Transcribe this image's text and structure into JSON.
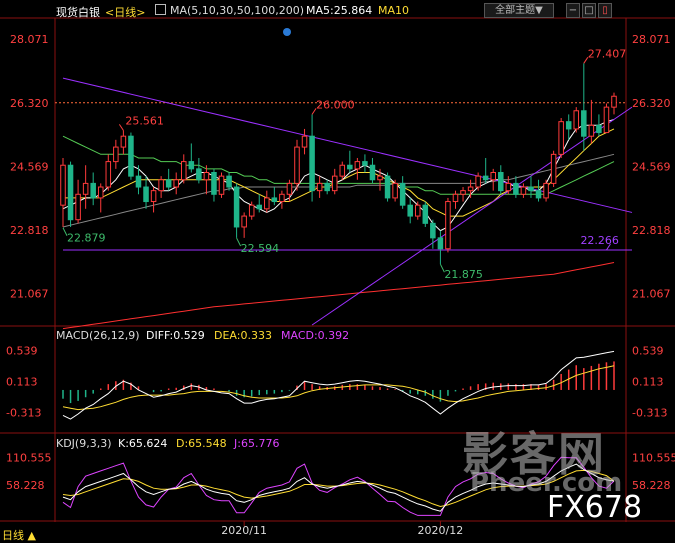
{
  "header": {
    "symbol_label": "现货白银",
    "period_label": "<日线>",
    "ma_label": "MA(5,10,30,50,100,200)",
    "ma5_label": "MA5:25.864",
    "ma10_label": "MA10",
    "theme_button": "全部主题▼"
  },
  "price_panel": {
    "y_ticks": [
      "28.071",
      "26.320",
      "24.569",
      "22.818",
      "21.067"
    ],
    "annotations": [
      {
        "text": "27.407",
        "color": "#ff4040"
      },
      {
        "text": "26.000",
        "color": "#ff4040"
      },
      {
        "text": "25.561",
        "color": "#ff4040"
      },
      {
        "text": "22.879",
        "color": "#3dbb6a"
      },
      {
        "text": "22.594",
        "color": "#3dbb6a"
      },
      {
        "text": "21.875",
        "color": "#3dbb6a"
      },
      {
        "text": "22.266",
        "color": "#a040ff"
      }
    ]
  },
  "macd_panel": {
    "label": "MACD(26,12,9)",
    "diff": "DIFF:0.529",
    "dea": "DEA:0.333",
    "macd": "MACD:0.392",
    "y_ticks": [
      "0.539",
      "0.113",
      "-0.313"
    ]
  },
  "kdj_panel": {
    "label": "KDJ(9,3,3)",
    "k": "K:65.624",
    "d": "D:65.548",
    "j": "J:65.776",
    "y_ticks": [
      "110.555",
      "58.228"
    ]
  },
  "x_axis": {
    "bottom_left_label": "日线 ▲",
    "ticks": [
      "2020/11",
      "2020/12"
    ]
  },
  "watermark": {
    "text1": "影客网",
    "text2": "Pheer.com",
    "text3": "FX678"
  },
  "colors": {
    "up": "#ff3b3b",
    "down": "#1fb58a",
    "ma5": "#ffffff",
    "ma10": "#ffdd33",
    "ma30": "#55cc55",
    "ma50": "#888888",
    "ma200": "#ff3030",
    "trend": "#9b30ff",
    "diff": "#ffffff",
    "dea": "#ffdd33",
    "k": "#ffffff",
    "d": "#ffdd33",
    "j": "#dd44ff"
  },
  "chart_data": {
    "type": "candlestick",
    "ylim": [
      20.2,
      28.6
    ],
    "candles": [
      {
        "o": 23.5,
        "h": 24.8,
        "l": 22.9,
        "c": 24.6
      },
      {
        "o": 24.6,
        "h": 24.7,
        "l": 22.9,
        "c": 23.1
      },
      {
        "o": 23.1,
        "h": 24.2,
        "l": 23.0,
        "c": 23.8
      },
      {
        "o": 23.8,
        "h": 24.6,
        "l": 23.4,
        "c": 24.1
      },
      {
        "o": 24.1,
        "h": 24.4,
        "l": 23.5,
        "c": 23.7
      },
      {
        "o": 23.7,
        "h": 24.1,
        "l": 23.3,
        "c": 24.0
      },
      {
        "o": 24.0,
        "h": 24.9,
        "l": 23.9,
        "c": 24.7
      },
      {
        "o": 24.7,
        "h": 25.3,
        "l": 24.5,
        "c": 25.1
      },
      {
        "o": 25.1,
        "h": 25.56,
        "l": 24.9,
        "c": 25.4
      },
      {
        "o": 25.4,
        "h": 25.5,
        "l": 24.2,
        "c": 24.3
      },
      {
        "o": 24.3,
        "h": 24.6,
        "l": 23.8,
        "c": 24.0
      },
      {
        "o": 24.0,
        "h": 24.3,
        "l": 23.4,
        "c": 23.6
      },
      {
        "o": 23.6,
        "h": 24.0,
        "l": 23.3,
        "c": 23.9
      },
      {
        "o": 23.9,
        "h": 24.3,
        "l": 23.7,
        "c": 24.2
      },
      {
        "o": 24.2,
        "h": 24.5,
        "l": 23.9,
        "c": 24.0
      },
      {
        "o": 24.0,
        "h": 24.4,
        "l": 23.8,
        "c": 24.2
      },
      {
        "o": 24.2,
        "h": 24.9,
        "l": 24.1,
        "c": 24.7
      },
      {
        "o": 24.7,
        "h": 25.2,
        "l": 24.4,
        "c": 24.5
      },
      {
        "o": 24.5,
        "h": 24.8,
        "l": 24.1,
        "c": 24.2
      },
      {
        "o": 24.2,
        "h": 24.6,
        "l": 23.8,
        "c": 24.4
      },
      {
        "o": 24.4,
        "h": 24.5,
        "l": 23.6,
        "c": 23.8
      },
      {
        "o": 23.8,
        "h": 24.4,
        "l": 23.7,
        "c": 24.3
      },
      {
        "o": 24.3,
        "h": 24.4,
        "l": 23.9,
        "c": 24.0
      },
      {
        "o": 24.0,
        "h": 24.1,
        "l": 22.6,
        "c": 22.9
      },
      {
        "o": 22.9,
        "h": 23.3,
        "l": 22.6,
        "c": 23.2
      },
      {
        "o": 23.2,
        "h": 23.6,
        "l": 23.1,
        "c": 23.5
      },
      {
        "o": 23.5,
        "h": 23.8,
        "l": 23.3,
        "c": 23.4
      },
      {
        "o": 23.4,
        "h": 23.9,
        "l": 23.3,
        "c": 23.7
      },
      {
        "o": 23.7,
        "h": 24.0,
        "l": 23.5,
        "c": 23.6
      },
      {
        "o": 23.6,
        "h": 23.9,
        "l": 23.4,
        "c": 23.8
      },
      {
        "o": 23.8,
        "h": 24.2,
        "l": 23.6,
        "c": 24.1
      },
      {
        "o": 24.1,
        "h": 25.3,
        "l": 23.9,
        "c": 25.1
      },
      {
        "o": 25.1,
        "h": 25.6,
        "l": 24.9,
        "c": 25.4
      },
      {
        "o": 25.4,
        "h": 26.0,
        "l": 23.6,
        "c": 23.9
      },
      {
        "o": 23.9,
        "h": 24.3,
        "l": 23.7,
        "c": 24.1
      },
      {
        "o": 24.1,
        "h": 24.2,
        "l": 23.8,
        "c": 23.9
      },
      {
        "o": 23.9,
        "h": 24.5,
        "l": 23.8,
        "c": 24.3
      },
      {
        "o": 24.3,
        "h": 24.7,
        "l": 24.2,
        "c": 24.6
      },
      {
        "o": 24.6,
        "h": 25.0,
        "l": 24.4,
        "c": 24.5
      },
      {
        "o": 24.5,
        "h": 24.8,
        "l": 24.2,
        "c": 24.7
      },
      {
        "o": 24.7,
        "h": 24.9,
        "l": 24.4,
        "c": 24.6
      },
      {
        "o": 24.6,
        "h": 24.8,
        "l": 24.1,
        "c": 24.2
      },
      {
        "o": 24.2,
        "h": 24.5,
        "l": 23.9,
        "c": 24.3
      },
      {
        "o": 24.3,
        "h": 24.4,
        "l": 23.6,
        "c": 23.7
      },
      {
        "o": 23.7,
        "h": 24.2,
        "l": 23.6,
        "c": 24.1
      },
      {
        "o": 24.1,
        "h": 24.3,
        "l": 23.4,
        "c": 23.5
      },
      {
        "o": 23.5,
        "h": 23.7,
        "l": 23.0,
        "c": 23.2
      },
      {
        "o": 23.2,
        "h": 23.6,
        "l": 23.1,
        "c": 23.5
      },
      {
        "o": 23.5,
        "h": 23.6,
        "l": 22.9,
        "c": 23.0
      },
      {
        "o": 23.0,
        "h": 23.1,
        "l": 22.3,
        "c": 22.6
      },
      {
        "o": 22.6,
        "h": 22.8,
        "l": 21.875,
        "c": 22.3
      },
      {
        "o": 22.3,
        "h": 23.7,
        "l": 22.2,
        "c": 23.6
      },
      {
        "o": 23.6,
        "h": 23.9,
        "l": 23.4,
        "c": 23.8
      },
      {
        "o": 23.8,
        "h": 24.0,
        "l": 23.6,
        "c": 23.9
      },
      {
        "o": 23.9,
        "h": 24.2,
        "l": 23.7,
        "c": 24.0
      },
      {
        "o": 24.0,
        "h": 24.4,
        "l": 23.9,
        "c": 24.3
      },
      {
        "o": 24.3,
        "h": 24.8,
        "l": 24.1,
        "c": 24.2
      },
      {
        "o": 24.2,
        "h": 24.5,
        "l": 23.9,
        "c": 24.4
      },
      {
        "o": 24.4,
        "h": 24.6,
        "l": 23.8,
        "c": 23.9
      },
      {
        "o": 23.9,
        "h": 24.3,
        "l": 23.8,
        "c": 24.1
      },
      {
        "o": 24.1,
        "h": 24.3,
        "l": 23.7,
        "c": 23.8
      },
      {
        "o": 23.8,
        "h": 24.1,
        "l": 23.7,
        "c": 24.0
      },
      {
        "o": 24.0,
        "h": 24.3,
        "l": 23.7,
        "c": 23.9
      },
      {
        "o": 23.9,
        "h": 24.2,
        "l": 23.6,
        "c": 23.7
      },
      {
        "o": 23.7,
        "h": 24.2,
        "l": 23.6,
        "c": 24.1
      },
      {
        "o": 24.1,
        "h": 25.0,
        "l": 24.0,
        "c": 24.9
      },
      {
        "o": 24.9,
        "h": 25.9,
        "l": 24.8,
        "c": 25.8
      },
      {
        "o": 25.8,
        "h": 26.0,
        "l": 25.3,
        "c": 25.6
      },
      {
        "o": 25.6,
        "h": 26.2,
        "l": 25.5,
        "c": 26.1
      },
      {
        "o": 26.1,
        "h": 27.407,
        "l": 25.0,
        "c": 25.4
      },
      {
        "o": 25.4,
        "h": 26.4,
        "l": 25.2,
        "c": 25.7
      },
      {
        "o": 25.7,
        "h": 26.0,
        "l": 25.4,
        "c": 25.5
      },
      {
        "o": 25.5,
        "h": 26.3,
        "l": 25.5,
        "c": 26.2
      },
      {
        "o": 26.2,
        "h": 26.6,
        "l": 26.0,
        "c": 26.5
      }
    ],
    "macd_hist": [
      -0.12,
      -0.18,
      -0.15,
      -0.1,
      -0.05,
      0.02,
      0.08,
      0.12,
      0.14,
      0.1,
      0.05,
      0.0,
      -0.03,
      -0.02,
      0.02,
      0.03,
      0.06,
      0.09,
      0.07,
      0.04,
      0.02,
      0.0,
      -0.02,
      -0.08,
      -0.1,
      -0.09,
      -0.07,
      -0.06,
      -0.05,
      -0.03,
      -0.01,
      0.06,
      0.12,
      0.08,
      0.05,
      0.04,
      0.05,
      0.07,
      0.08,
      0.08,
      0.07,
      0.05,
      0.04,
      0.02,
      0.01,
      -0.02,
      -0.05,
      -0.06,
      -0.08,
      -0.12,
      -0.16,
      -0.08,
      -0.02,
      0.02,
      0.05,
      0.08,
      0.09,
      0.1,
      0.09,
      0.09,
      0.08,
      0.08,
      0.08,
      0.07,
      0.08,
      0.14,
      0.22,
      0.28,
      0.34,
      0.3,
      0.33,
      0.36,
      0.38,
      0.392
    ],
    "diff": [
      -0.35,
      -0.4,
      -0.33,
      -0.25,
      -0.2,
      -0.12,
      -0.05,
      0.05,
      0.12,
      0.08,
      0.0,
      -0.05,
      -0.1,
      -0.08,
      -0.05,
      -0.03,
      0.02,
      0.06,
      0.04,
      0.0,
      -0.02,
      -0.04,
      -0.05,
      -0.12,
      -0.18,
      -0.18,
      -0.15,
      -0.13,
      -0.12,
      -0.1,
      -0.08,
      0.02,
      0.12,
      0.1,
      0.08,
      0.07,
      0.08,
      0.1,
      0.12,
      0.13,
      0.12,
      0.1,
      0.08,
      0.05,
      0.03,
      -0.02,
      -0.08,
      -0.12,
      -0.17,
      -0.25,
      -0.33,
      -0.25,
      -0.18,
      -0.12,
      -0.07,
      -0.02,
      0.02,
      0.04,
      0.05,
      0.06,
      0.06,
      0.06,
      0.07,
      0.07,
      0.09,
      0.17,
      0.28,
      0.36,
      0.44,
      0.45,
      0.47,
      0.49,
      0.51,
      0.529
    ],
    "dea": [
      -0.23,
      -0.25,
      -0.27,
      -0.26,
      -0.25,
      -0.23,
      -0.2,
      -0.17,
      -0.13,
      -0.1,
      -0.08,
      -0.07,
      -0.07,
      -0.07,
      -0.07,
      -0.06,
      -0.05,
      -0.03,
      -0.02,
      -0.02,
      -0.02,
      -0.02,
      -0.03,
      -0.05,
      -0.08,
      -0.1,
      -0.11,
      -0.11,
      -0.11,
      -0.11,
      -0.1,
      -0.08,
      -0.04,
      -0.01,
      0.01,
      0.02,
      0.03,
      0.04,
      0.05,
      0.06,
      0.07,
      0.07,
      0.07,
      0.07,
      0.06,
      0.05,
      0.03,
      0.0,
      -0.03,
      -0.08,
      -0.12,
      -0.15,
      -0.16,
      -0.15,
      -0.13,
      -0.11,
      -0.08,
      -0.06,
      -0.04,
      -0.02,
      -0.01,
      0.0,
      0.01,
      0.02,
      0.03,
      0.06,
      0.1,
      0.15,
      0.2,
      0.23,
      0.26,
      0.29,
      0.31,
      0.333
    ],
    "kdj_k": [
      35,
      30,
      45,
      55,
      60,
      65,
      70,
      75,
      80,
      68,
      55,
      45,
      40,
      45,
      50,
      52,
      60,
      65,
      58,
      50,
      45,
      42,
      40,
      28,
      25,
      30,
      38,
      42,
      45,
      48,
      52,
      65,
      72,
      60,
      55,
      52,
      55,
      58,
      62,
      65,
      63,
      58,
      52,
      45,
      42,
      35,
      28,
      22,
      18,
      12,
      8,
      25,
      35,
      42,
      48,
      55,
      60,
      62,
      60,
      58,
      56,
      55,
      58,
      60,
      65,
      75,
      85,
      92,
      98,
      88,
      80,
      72,
      68,
      65.6
    ],
    "kdj_d": [
      40,
      38,
      40,
      45,
      50,
      55,
      60,
      65,
      70,
      69,
      65,
      58,
      52,
      50,
      50,
      51,
      54,
      58,
      58,
      56,
      52,
      49,
      46,
      40,
      35,
      33,
      35,
      37,
      40,
      43,
      46,
      52,
      59,
      59,
      58,
      56,
      56,
      57,
      59,
      61,
      62,
      61,
      58,
      54,
      50,
      45,
      39,
      33,
      28,
      22,
      17,
      20,
      25,
      31,
      37,
      43,
      49,
      53,
      55,
      56,
      56,
      56,
      57,
      58,
      60,
      65,
      72,
      79,
      85,
      86,
      84,
      80,
      76,
      65.5
    ],
    "kdj_j": [
      25,
      15,
      55,
      75,
      80,
      85,
      90,
      95,
      100,
      66,
      35,
      20,
      16,
      35,
      50,
      54,
      72,
      80,
      58,
      38,
      30,
      28,
      28,
      5,
      5,
      24,
      44,
      52,
      55,
      58,
      64,
      90,
      98,
      62,
      48,
      44,
      53,
      60,
      68,
      73,
      65,
      52,
      40,
      27,
      26,
      15,
      6,
      0,
      0,
      0,
      0,
      35,
      55,
      64,
      70,
      79,
      82,
      80,
      70,
      62,
      56,
      53,
      60,
      64,
      75,
      95,
      111,
      110,
      110,
      92,
      72,
      56,
      52,
      65.8
    ],
    "ma5": [
      23.4,
      23.5,
      23.6,
      23.7,
      23.7,
      23.8,
      24.0,
      24.2,
      24.5,
      24.6,
      24.5,
      24.3,
      24.0,
      23.9,
      23.9,
      24.0,
      24.2,
      24.3,
      24.4,
      24.4,
      24.3,
      24.2,
      24.1,
      23.8,
      23.6,
      23.5,
      23.4,
      23.3,
      23.4,
      23.6,
      23.7,
      24.0,
      24.3,
      24.4,
      24.3,
      24.2,
      24.1,
      24.2,
      24.4,
      24.5,
      24.6,
      24.5,
      24.4,
      24.3,
      24.1,
      23.9,
      23.7,
      23.5,
      23.3,
      23.0,
      22.8,
      22.9,
      23.2,
      23.5,
      23.8,
      24.0,
      24.1,
      24.2,
      24.2,
      24.1,
      24.0,
      24.0,
      23.9,
      23.9,
      24.1,
      24.5,
      24.9,
      25.3,
      25.6,
      25.7,
      25.7,
      25.7,
      25.8,
      25.86
    ],
    "ma10": [
      23.7,
      23.7,
      23.7,
      23.7,
      23.7,
      23.7,
      23.8,
      23.9,
      24.0,
      24.1,
      24.2,
      24.2,
      24.2,
      24.2,
      24.2,
      24.2,
      24.2,
      24.2,
      24.2,
      24.2,
      24.2,
      24.2,
      24.2,
      24.1,
      24.0,
      23.9,
      23.8,
      23.7,
      23.6,
      23.6,
      23.6,
      23.7,
      23.8,
      23.9,
      24.0,
      24.0,
      24.1,
      24.2,
      24.3,
      24.4,
      24.4,
      24.4,
      24.3,
      24.2,
      24.1,
      24.0,
      23.9,
      23.7,
      23.6,
      23.4,
      23.3,
      23.2,
      23.2,
      23.2,
      23.3,
      23.4,
      23.5,
      23.6,
      23.8,
      23.9,
      24.0,
      24.0,
      24.0,
      24.0,
      24.0,
      24.2,
      24.4,
      24.6,
      24.8,
      25.0,
      25.2,
      25.4,
      25.5,
      25.6
    ],
    "ma30": [
      25.4,
      25.3,
      25.2,
      25.1,
      25.0,
      24.9,
      24.9,
      24.9,
      24.9,
      24.9,
      24.8,
      24.8,
      24.8,
      24.7,
      24.7,
      24.7,
      24.6,
      24.6,
      24.6,
      24.5,
      24.5,
      24.5,
      24.4,
      24.4,
      24.3,
      24.3,
      24.2,
      24.2,
      24.1,
      24.1,
      24.1,
      24.1,
      24.1,
      24.1,
      24.1,
      24.1,
      24.1,
      24.1,
      24.1,
      24.1,
      24.1,
      24.1,
      24.1,
      24.1,
      24.1,
      24.0,
      24.0,
      24.0,
      23.9,
      23.9,
      23.8,
      23.8,
      23.8,
      23.8,
      23.8,
      23.8,
      23.8,
      23.8,
      23.8,
      23.8,
      23.8,
      23.8,
      23.8,
      23.8,
      23.8,
      23.9,
      24.0,
      24.1,
      24.2,
      24.3,
      24.4,
      24.5,
      24.6,
      24.7
    ],
    "ma50": [
      22.9,
      22.95,
      23.0,
      23.05,
      23.1,
      23.15,
      23.2,
      23.25,
      23.3,
      23.35,
      23.4,
      23.45,
      23.5,
      23.55,
      23.6,
      23.65,
      23.7,
      23.75,
      23.8,
      23.85,
      23.9,
      23.9,
      23.95,
      23.95,
      24.0,
      24.0,
      24.0,
      24.0,
      24.0,
      24.0,
      24.0,
      24.0,
      24.0,
      24.0,
      24.0,
      24.0,
      24.0,
      24.0,
      24.0,
      24.05,
      24.05,
      24.05,
      24.05,
      24.05,
      24.1,
      24.1,
      24.1,
      24.1,
      24.1,
      24.1,
      24.1,
      24.1,
      24.1,
      24.1,
      24.1,
      24.1,
      24.15,
      24.15,
      24.2,
      24.2,
      24.25,
      24.3,
      24.35,
      24.4,
      24.45,
      24.5,
      24.55,
      24.6,
      24.65,
      24.7,
      24.75,
      24.8,
      24.85,
      24.9
    ],
    "ma200": [
      20.1,
      20.13,
      20.16,
      20.19,
      20.22,
      20.25,
      20.28,
      20.31,
      20.34,
      20.37,
      20.4,
      20.43,
      20.46,
      20.49,
      20.52,
      20.55,
      20.58,
      20.61,
      20.64,
      20.67,
      20.7,
      20.72,
      20.74,
      20.76,
      20.78,
      20.8,
      20.82,
      20.84,
      20.86,
      20.88,
      20.9,
      20.92,
      20.94,
      20.96,
      20.98,
      21.0,
      21.02,
      21.04,
      21.06,
      21.08,
      21.1,
      21.12,
      21.14,
      21.16,
      21.18,
      21.2,
      21.22,
      21.24,
      21.26,
      21.28,
      21.3,
      21.32,
      21.34,
      21.36,
      21.38,
      21.4,
      21.42,
      21.44,
      21.46,
      21.48,
      21.5,
      21.52,
      21.54,
      21.56,
      21.58,
      21.6,
      21.64,
      21.68,
      21.72,
      21.76,
      21.8,
      21.84,
      21.88,
      21.92
    ],
    "trend_lines": [
      {
        "from": [
          0,
          27.0
        ],
        "to": [
          73,
          23.3
        ]
      },
      {
        "from": [
          0,
          22.266
        ],
        "to": [
          73,
          22.266
        ]
      },
      {
        "from": [
          33,
          20.2
        ],
        "to": [
          73,
          26.2
        ]
      }
    ],
    "dashed_level": 26.32
  }
}
